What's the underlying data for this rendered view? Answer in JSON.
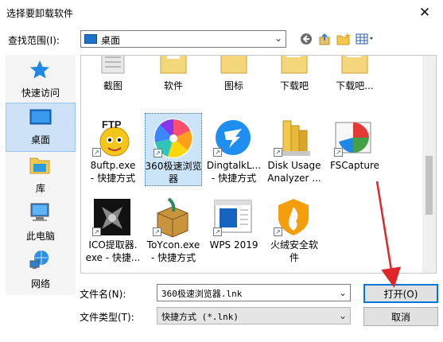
{
  "window": {
    "title": "选择要卸载软件",
    "close_glyph": "✕"
  },
  "lookin": {
    "label": "查找范围(I):",
    "value": "桌面"
  },
  "places": [
    {
      "label": "快速访问",
      "icon": "star-icon"
    },
    {
      "label": "桌面",
      "icon": "desktop-icon"
    },
    {
      "label": "库",
      "icon": "library-icon"
    },
    {
      "label": "此电脑",
      "icon": "computer-icon"
    },
    {
      "label": "网络",
      "icon": "network-icon"
    }
  ],
  "folders_row": [
    {
      "name": "截图"
    },
    {
      "name": "软件"
    },
    {
      "name": "图标"
    },
    {
      "name": "下载吧"
    },
    {
      "name": "下载吧..."
    }
  ],
  "files_row1": [
    {
      "line1": "8uftp.exe",
      "line2": "- 快捷方式"
    },
    {
      "line1": "360极速浏览",
      "line2": "器"
    },
    {
      "line1": "DingtalkL...",
      "line2": "- 快捷方式"
    },
    {
      "line1": "Disk Usage",
      "line2": "Analyzer ..."
    },
    {
      "line1": "FSCapture",
      "line2": ""
    }
  ],
  "files_row2": [
    {
      "line1": "ICO提取器.",
      "line2": "exe - 快捷..."
    },
    {
      "line1": "ToYcon.exe",
      "line2": "- 快捷方式"
    },
    {
      "line1": "WPS 2019",
      "line2": ""
    },
    {
      "line1": "火绒安全软",
      "line2": "件"
    }
  ],
  "filename": {
    "label": "文件名(N):",
    "value": "360极速浏览器.lnk"
  },
  "filetype": {
    "label": "文件类型(T):",
    "value": "快捷方式 (*.lnk)"
  },
  "buttons": {
    "open": "打开(O)",
    "cancel": "取消"
  },
  "icon_text": {
    "ftp": "FTP"
  },
  "colors": {
    "accent": "#0078d7",
    "selection": "#cce4f7",
    "arrow": "#e0262a"
  }
}
